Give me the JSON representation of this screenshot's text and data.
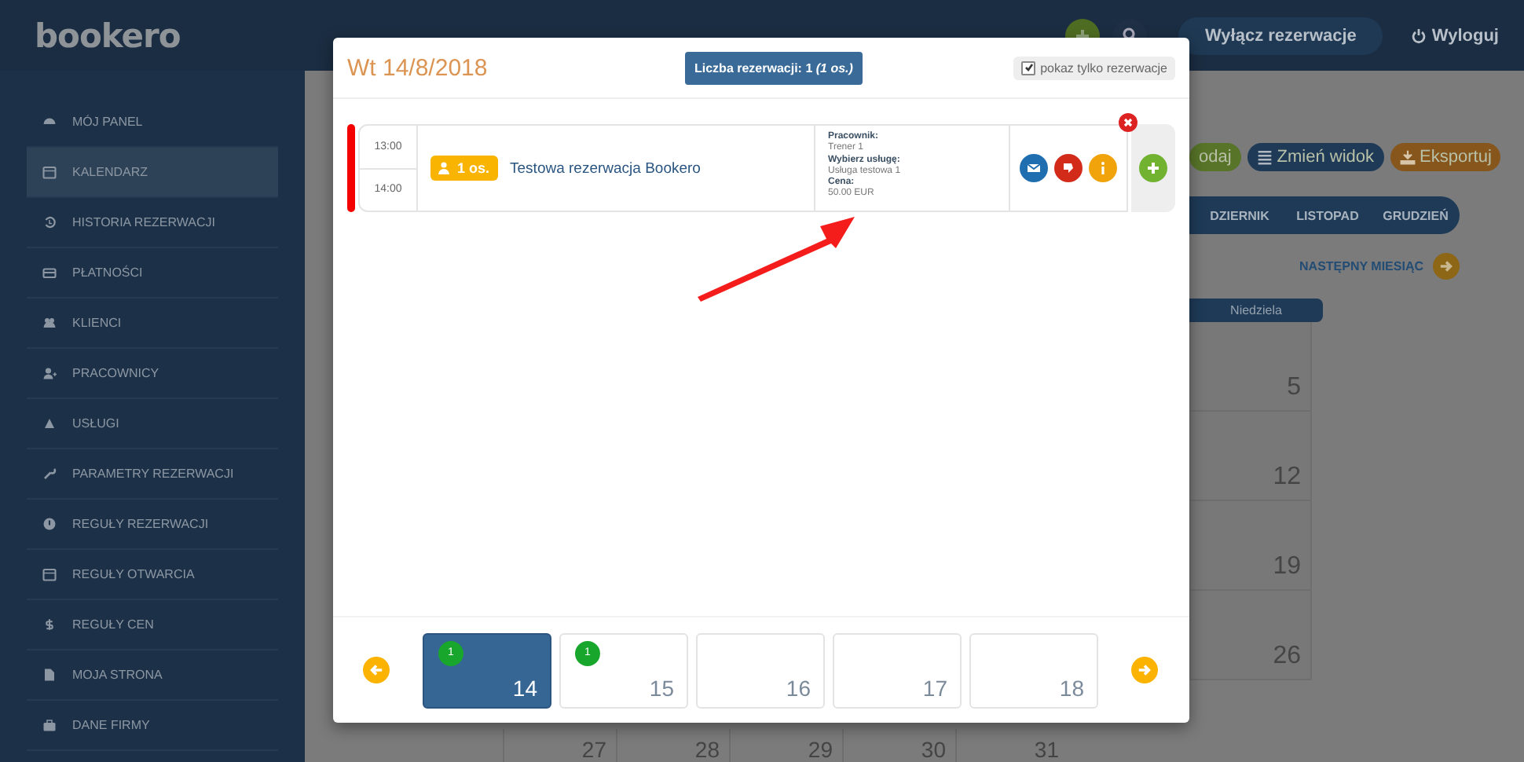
{
  "header": {
    "logo": "bookero",
    "disable_button": "Wyłącz rezerwacje",
    "logout": "Wyloguj"
  },
  "sidebar": {
    "items": [
      {
        "label": "MÓJ PANEL",
        "kind": "dashboard",
        "selected": false
      },
      {
        "label": "KALENDARZ",
        "kind": "calendar",
        "selected": true
      },
      {
        "label": "HISTORIA REZERWACJI",
        "kind": "history",
        "selected": false
      },
      {
        "label": "PŁATNOŚCI",
        "kind": "card",
        "selected": false
      },
      {
        "label": "KLIENCI",
        "kind": "users",
        "selected": false
      },
      {
        "label": "PRACOWNICY",
        "kind": "staff",
        "selected": false
      },
      {
        "label": "USŁUGI",
        "kind": "services",
        "selected": false
      },
      {
        "label": "PARAMETRY REZERWACJI",
        "kind": "wrench",
        "selected": false
      },
      {
        "label": "REGUŁY REZERWACJI",
        "kind": "alert",
        "selected": false
      },
      {
        "label": "REGUŁY OTWARCIA",
        "kind": "calendar",
        "selected": false
      },
      {
        "label": "REGUŁY CEN",
        "kind": "dollar",
        "selected": false
      },
      {
        "label": "MOJA STRONA",
        "kind": "file",
        "selected": false
      },
      {
        "label": "DANE FIRMY",
        "kind": "briefcase",
        "selected": false
      }
    ]
  },
  "toolbar": {
    "buttons": [
      {
        "label": "odaj",
        "kind": "add",
        "color": "#577428"
      },
      {
        "label": "Zmień widok",
        "kind": "view",
        "color": "#1e3a57"
      },
      {
        "label": "Eksportuj",
        "kind": "export",
        "color": "#86561c"
      }
    ]
  },
  "months": [
    "DZIERNIK",
    "LISTOPAD",
    "GRUDZIEŃ"
  ],
  "next_month": "NASTĘPNY MIESIĄC",
  "calendar": {
    "weekday": "Niedziela",
    "sunday_days": [
      "5",
      "12",
      "19",
      "26"
    ],
    "last_row_days": [
      "27",
      "28",
      "29",
      "30",
      "31"
    ]
  },
  "modal": {
    "title": "Wt 14/8/2018",
    "count_button": "Liczba rezerwacji: 1 *(1 os.)*",
    "filter": {
      "label": "pokaz tylko rezerwacje",
      "checked": true
    },
    "reservations": [
      {
        "start": "13:00",
        "end": "14:00",
        "people": "1 os.",
        "title": "Testowa rezerwacja Bookero",
        "details": [
          {
            "label": "Pracownik:",
            "value": "Trener 1"
          },
          {
            "label": "Wybierz usługę:",
            "value": "Usługa testowa 1"
          },
          {
            "label": "Cena:",
            "value": "50.00 EUR"
          }
        ],
        "actions": [
          {
            "kind": "mail"
          },
          {
            "kind": "reject"
          },
          {
            "kind": "info"
          }
        ]
      }
    ],
    "days": [
      {
        "day": "14",
        "count": "1",
        "selected": true
      },
      {
        "day": "15",
        "count": "1",
        "selected": false
      },
      {
        "day": "16",
        "selected": false
      },
      {
        "day": "17",
        "selected": false
      },
      {
        "day": "18",
        "selected": false
      }
    ]
  }
}
